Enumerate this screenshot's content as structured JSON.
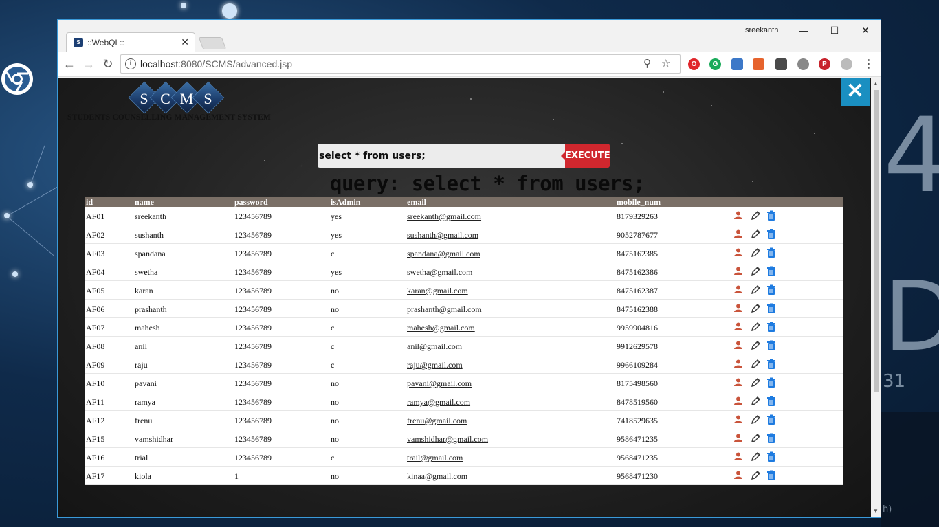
{
  "desktop": {
    "big_text_1": "4",
    "big_text_2": "D",
    "small_text": "31",
    "side_text": "h)"
  },
  "browser": {
    "profile_name": "sreekanth",
    "tab": {
      "title": "::WebQL::",
      "favicon": "S"
    },
    "address": {
      "host": "localhost",
      "path": ":8080/SCMS/advanced.jsp"
    },
    "window_controls": {
      "minimize": "—",
      "maximize": "☐",
      "close": "✕"
    }
  },
  "page": {
    "logo": {
      "letters": [
        "S",
        "C",
        "M",
        "S"
      ],
      "subtitle": "STUDENTS COUNSELLING MANAGEMENT SYSTEM"
    },
    "query_input_value": "select * from users;",
    "execute_label": "EXECUTE",
    "query_heading": "query: select * from users;",
    "columns": [
      "id",
      "name",
      "password",
      "isAdmin",
      "email",
      "mobile_num"
    ],
    "rows": [
      [
        "AF01",
        "sreekanth",
        "123456789",
        "yes",
        "sreekanth@gmail.com",
        "8179329263"
      ],
      [
        "AF02",
        "sushanth",
        "123456789",
        "yes",
        "sushanth@gmail.com",
        "9052787677"
      ],
      [
        "AF03",
        "spandana",
        "123456789",
        "c",
        "spandana@gmail.com",
        "8475162385"
      ],
      [
        "AF04",
        "swetha",
        "123456789",
        "yes",
        "swetha@gmail.com",
        "8475162386"
      ],
      [
        "AF05",
        "karan",
        "123456789",
        "no",
        "karan@gmail.com",
        "8475162387"
      ],
      [
        "AF06",
        "prashanth",
        "123456789",
        "no",
        "prashanth@gmail.com",
        "8475162388"
      ],
      [
        "AF07",
        "mahesh",
        "123456789",
        "c",
        "mahesh@gmail.com",
        "9959904816"
      ],
      [
        "AF08",
        "anil",
        "123456789",
        "c",
        "anil@gmail.com",
        "9912629578"
      ],
      [
        "AF09",
        "raju",
        "123456789",
        "c",
        "raju@gmail.com",
        "9966109284"
      ],
      [
        "AF10",
        "pavani",
        "123456789",
        "no",
        "pavani@gmail.com",
        "8175498560"
      ],
      [
        "AF11",
        "ramya",
        "123456789",
        "no",
        "ramya@gmail.com",
        "8478519560"
      ],
      [
        "AF12",
        "frenu",
        "123456789",
        "no",
        "frenu@gmail.com",
        "7418529635"
      ],
      [
        "AF15",
        "vamshidhar",
        "123456789",
        "no",
        "vamshidhar@gmail.com",
        "9586471235"
      ],
      [
        "AF16",
        "trial",
        "123456789",
        "c",
        "trail@gmail.com",
        "9568471235"
      ],
      [
        "AF17",
        "kiola",
        "1",
        "no",
        "kinaa@gmail.com",
        "9568471230"
      ]
    ],
    "row_actions": [
      "user-icon",
      "edit-pencil-icon",
      "delete-trash-icon"
    ],
    "colors": {
      "execute": "#d0272e",
      "close_overlay": "#1a8fc1",
      "table_header": "#7a6f66"
    }
  }
}
